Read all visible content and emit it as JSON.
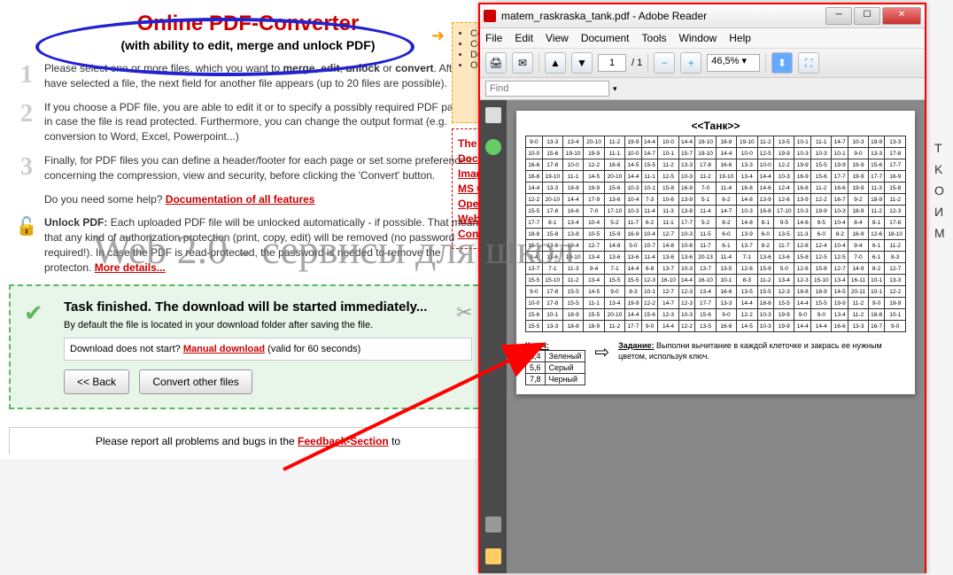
{
  "header": {
    "title": "Online PDF-Converter",
    "subtitle": "(with ability to edit, merge and unlock PDF)"
  },
  "steps": [
    {
      "n": "1",
      "html": "Please select one or more files, which you want to <b>merge</b>, <b>edit</b>, <b>unlock</b> or <b>convert</b>. After you have selected a file, the next field for another file appears (up to 20 files are possible)."
    },
    {
      "n": "2",
      "html": "If you choose a PDF file, you are able to edit it or to specify a possibly required PDF password in case the file is read protected. Furthermore, you can change the output format (e.g. conversion to Word, Excel, Powerpoint...)"
    },
    {
      "n": "3",
      "html": "Finally, for PDF files you can define a header/footer for each page or set some preferences concerning the compression, view and security, before clicking the 'Convert' button."
    }
  ],
  "help": {
    "text": "Do you need some help?",
    "link": "Documentation of all features"
  },
  "unlock": {
    "title": "Unlock PDF:",
    "text": "Each uploaded PDF file will be unlocked automatically - if possible. That means, that any kind of authorization protection (print, copy, edit) will be removed (no password required!). In case the PDF is read-protected, the password is needed to remove the protecton.",
    "link": "More details..."
  },
  "finished": {
    "title": "Task finished. The download will be started immediately...",
    "sub": "By default the file is located in your download folder after saving the file.",
    "dl_q": "Download does not start?",
    "dl_link": "Manual download",
    "dl_valid": "(valid for 60 seconds)",
    "back": "<< Back",
    "other": "Convert other files"
  },
  "footer": {
    "text": "Please report all problems and bugs in the",
    "link": "Feedback-Section",
    "tail": " to"
  },
  "rc": {
    "items": [
      "Co",
      "Co",
      "Do",
      "Op"
    ]
  },
  "rr": {
    "title": "The",
    "items": [
      "Docu",
      "Imag",
      "MS C",
      "Ope",
      "Web",
      "Cont"
    ]
  },
  "side_letters": [
    "T",
    "K",
    "O",
    "И",
    "M"
  ],
  "watermark": "Web 2.0 - сервисы для школ",
  "reader": {
    "title": "matem_raskraska_tank.pdf - Adobe Reader",
    "menus": [
      "File",
      "Edit",
      "View",
      "Document",
      "Tools",
      "Window",
      "Help"
    ],
    "page": "1",
    "pages": "/ 1",
    "zoom": "46,5%",
    "find_ph": "Find",
    "doc_title": "<<Танк>>",
    "grid": [
      [
        "9-0",
        "13-3",
        "13-4",
        "20-10",
        "11-2",
        "19-9",
        "14-4",
        "10-0",
        "14-4",
        "19-10",
        "18-8",
        "19-10",
        "11-2",
        "13-5",
        "10-1",
        "11-1",
        "14-7",
        "10-3",
        "19-9",
        "13-3"
      ],
      [
        "10-0",
        "15-6",
        "19-10",
        "19-9",
        "11-1",
        "10-0",
        "14-7",
        "10-1",
        "15-7",
        "19-10",
        "14-4",
        "10-0",
        "12-5",
        "19-9",
        "10-3",
        "10-3",
        "10-1",
        "9-0",
        "13-3",
        "17-8"
      ],
      [
        "16-6",
        "17-8",
        "10-0",
        "12-2",
        "16-6",
        "14-5",
        "15-5",
        "11-2",
        "13-3",
        "17-8",
        "16-6",
        "13-3",
        "10-0",
        "12-2",
        "19-9",
        "15-5",
        "19-9",
        "19-9",
        "15-6",
        "17-7"
      ],
      [
        "18-8",
        "19-10",
        "11-1",
        "14-5",
        "20-10",
        "14-4",
        "11-1",
        "12-5",
        "10-3",
        "11-2",
        "19-10",
        "13-4",
        "14-4",
        "10-3",
        "16-9",
        "15-6",
        "17-7",
        "19-9",
        "17-7",
        "16-9"
      ],
      [
        "14-4",
        "13-3",
        "18-8",
        "19-9",
        "15-6",
        "10-3",
        "10-1",
        "15-8",
        "16-9",
        "7-0",
        "11-4",
        "16-8",
        "14-6",
        "12-4",
        "16-8",
        "11-2",
        "16-6",
        "19-9",
        "11-3",
        "15-8"
      ],
      [
        "12-2",
        "20-10",
        "14-4",
        "17-9",
        "13-6",
        "10-4",
        "7-3",
        "10-6",
        "13-9",
        "5-1",
        "6-2",
        "14-8",
        "13-9",
        "12-6",
        "13-9",
        "12-2",
        "16-7",
        "9-2",
        "18-9",
        "11-2"
      ],
      [
        "15-5",
        "17-8",
        "16-6",
        "7-0",
        "17-10",
        "10-3",
        "11-4",
        "11-3",
        "13-8",
        "11-4",
        "14-7",
        "10-3",
        "16-8",
        "17-10",
        "10-3",
        "19-9",
        "10-3",
        "18-9",
        "11-2",
        "12-3"
      ],
      [
        "17-7",
        "8-1",
        "13-4",
        "10-4",
        "5-2",
        "11-7",
        "6-2",
        "11-1",
        "17-7",
        "5-2",
        "8-2",
        "14-8",
        "8-1",
        "9-5",
        "14-6",
        "9-5",
        "10-4",
        "8-4",
        "8-1",
        "17-8"
      ],
      [
        "18-8",
        "15-8",
        "13-8",
        "10-5",
        "15-9",
        "16-9",
        "10-4",
        "12-7",
        "10-3",
        "11-5",
        "6-0",
        "13-9",
        "6-0",
        "13-5",
        "11-3",
        "6-0",
        "8-2",
        "16-9",
        "12-6",
        "18-10"
      ],
      [
        "15-5",
        "13-6",
        "10-4",
        "12-7",
        "14-8",
        "5-0",
        "10-7",
        "14-8",
        "10-6",
        "11-7",
        "6-1",
        "13-7",
        "8-2",
        "11-7",
        "12-8",
        "12-4",
        "10-4",
        "9-4",
        "6-1",
        "11-2"
      ],
      [
        "9-4",
        "11-6",
        "19-10",
        "13-4",
        "13-6",
        "13-6",
        "11-4",
        "13-6",
        "13-6",
        "20-13",
        "11-4",
        "7-1",
        "13-6",
        "13-6",
        "15-8",
        "12-5",
        "12-5",
        "7-0",
        "6-1",
        "8-3"
      ],
      [
        "13-7",
        "7-1",
        "11-3",
        "9-4",
        "7-1",
        "14-4",
        "6-8",
        "13-7",
        "10-3",
        "13-7",
        "13-5",
        "12-6",
        "15-9",
        "5-0",
        "12-6",
        "15-8",
        "12-7",
        "14-9",
        "8-2",
        "12-7"
      ],
      [
        "15-5",
        "15-10",
        "11-2",
        "13-4",
        "15-5",
        "15-5",
        "12-3",
        "16-10",
        "14-4",
        "16-10",
        "10-1",
        "8-3",
        "11-2",
        "13-4",
        "12-3",
        "15-10",
        "13-4",
        "16-11",
        "10-1",
        "13-3"
      ],
      [
        "9-0",
        "17-8",
        "15-5",
        "14-5",
        "9-0",
        "8-3",
        "10-1",
        "12-7",
        "12-3",
        "13-4",
        "16-6",
        "13-5",
        "15-5",
        "12-3",
        "18-8",
        "18-9",
        "14-5",
        "20-11",
        "10-1",
        "12-2"
      ],
      [
        "10-0",
        "17-8",
        "15-5",
        "11-1",
        "13-4",
        "19-9",
        "12-2",
        "14-7",
        "12-3",
        "17-7",
        "13-3",
        "14-4",
        "18-8",
        "15-5",
        "14-4",
        "15-5",
        "19-9",
        "11-2",
        "9-0",
        "19-9"
      ],
      [
        "15-6",
        "10-1",
        "18-9",
        "15-5",
        "20-10",
        "14-4",
        "15-6",
        "12-3",
        "10-3",
        "15-6",
        "9-0",
        "12-2",
        "10-3",
        "19-9",
        "9-0",
        "9-0",
        "13-4",
        "11-2",
        "18-8",
        "10-1"
      ],
      [
        "15-5",
        "13-3",
        "18-8",
        "18-9",
        "11-2",
        "17-7",
        "9-0",
        "14-4",
        "12-2",
        "13-5",
        "16-6",
        "14-5",
        "10-3",
        "19-9",
        "14-4",
        "14-4",
        "16-6",
        "13-3",
        "16-7",
        "9-0"
      ]
    ],
    "key_title": "Ключ:",
    "key": [
      [
        "3,4",
        "Зеленый"
      ],
      [
        "5,6",
        "Серый"
      ],
      [
        "7,8",
        "Черный"
      ]
    ],
    "task_title": "Задание:",
    "task_text": "Выполни вычитание в каждой клеточке и закрась ее нужным цветом, используя ключ."
  }
}
